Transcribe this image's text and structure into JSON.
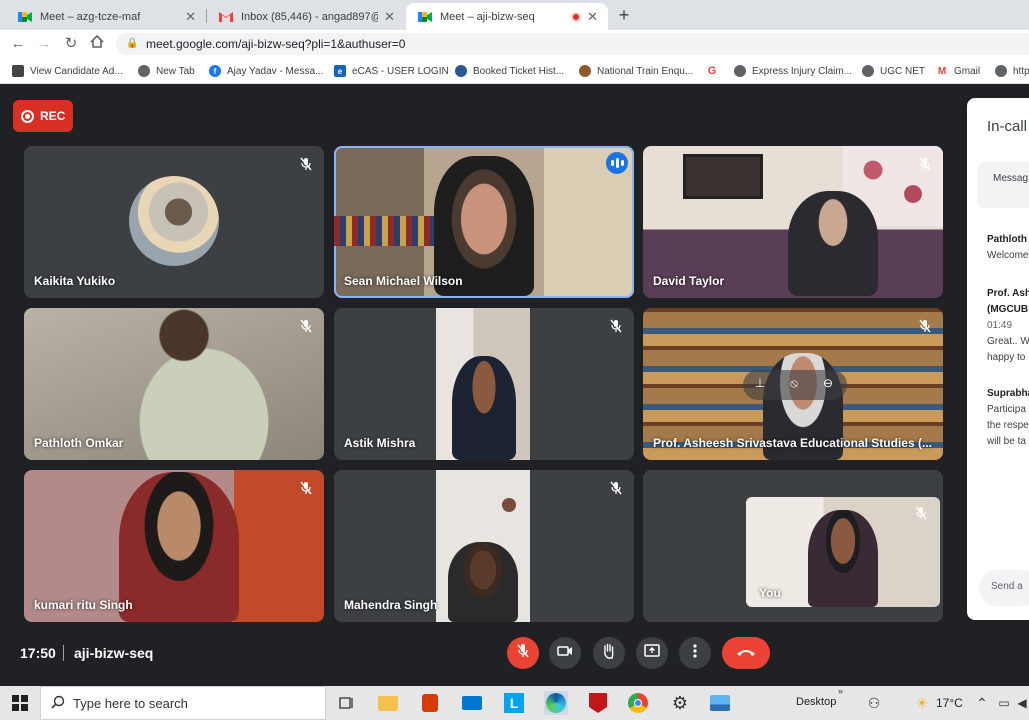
{
  "browser": {
    "tabs": [
      {
        "title": "Meet – azg-tcze-maf",
        "close": "✕"
      },
      {
        "title": "Inbox (85,446) - angad897@gma",
        "close": "✕"
      },
      {
        "title": "Meet – aji-bizw-seq",
        "close": "✕"
      }
    ],
    "new_tab": "+",
    "url": "meet.google.com/aji-bizw-seq?pli=1&authuser=0"
  },
  "bookmarks": [
    {
      "label": "View Candidate Ad...",
      "icon": "person-icon"
    },
    {
      "label": "New Tab",
      "icon": "globe-icon"
    },
    {
      "label": "Ajay Yadav - Messa...",
      "icon": "facebook-icon"
    },
    {
      "label": "eCAS - USER LOGIN",
      "icon": "ecas-icon"
    },
    {
      "label": "Booked Ticket Hist...",
      "icon": "train-icon"
    },
    {
      "label": "National Train Enqu...",
      "icon": "train-icon"
    },
    {
      "label": "",
      "icon": "google-icon"
    },
    {
      "label": "Express Injury Claim...",
      "icon": "globe-icon"
    },
    {
      "label": "UGC NET",
      "icon": "globe-icon"
    },
    {
      "label": "Gmail",
      "icon": "gmail-icon"
    },
    {
      "label": "http",
      "icon": "globe-icon"
    }
  ],
  "meet": {
    "rec_label": "REC",
    "participants": [
      {
        "name": "Kaikita Yukiko"
      },
      {
        "name": "Sean Michael Wilson"
      },
      {
        "name": "David Taylor"
      },
      {
        "name": "Pathloth Omkar"
      },
      {
        "name": "Astik Mishra"
      },
      {
        "name": "Prof. Asheesh Srivastava Educational Studies (..."
      },
      {
        "name": "kumari ritu Singh"
      },
      {
        "name": "Mahendra Singh"
      },
      {
        "name": "You"
      }
    ],
    "clock": "17:50",
    "meeting_code": "aji-bizw-seq"
  },
  "panel": {
    "title": "In-call",
    "note": "Messag",
    "messages": [
      {
        "lines": [
          "Pathloth",
          "Welcome"
        ]
      },
      {
        "lines": [
          "Prof. Ash",
          "(MGCUB",
          "01:49",
          "Great.. W",
          "happy to"
        ]
      },
      {
        "lines": [
          "Suprabha",
          "Participa",
          "the respe",
          "will be ta"
        ]
      }
    ],
    "send_placeholder": "Send a"
  },
  "taskbar": {
    "search_placeholder": "Type here to search",
    "desktop_label": "Desktop",
    "temperature": "17°C"
  },
  "colors": {
    "meet_bg": "#202124",
    "tile_bg": "#3c4043",
    "red": "#ea4335",
    "speaking": "#8ab4f8"
  }
}
